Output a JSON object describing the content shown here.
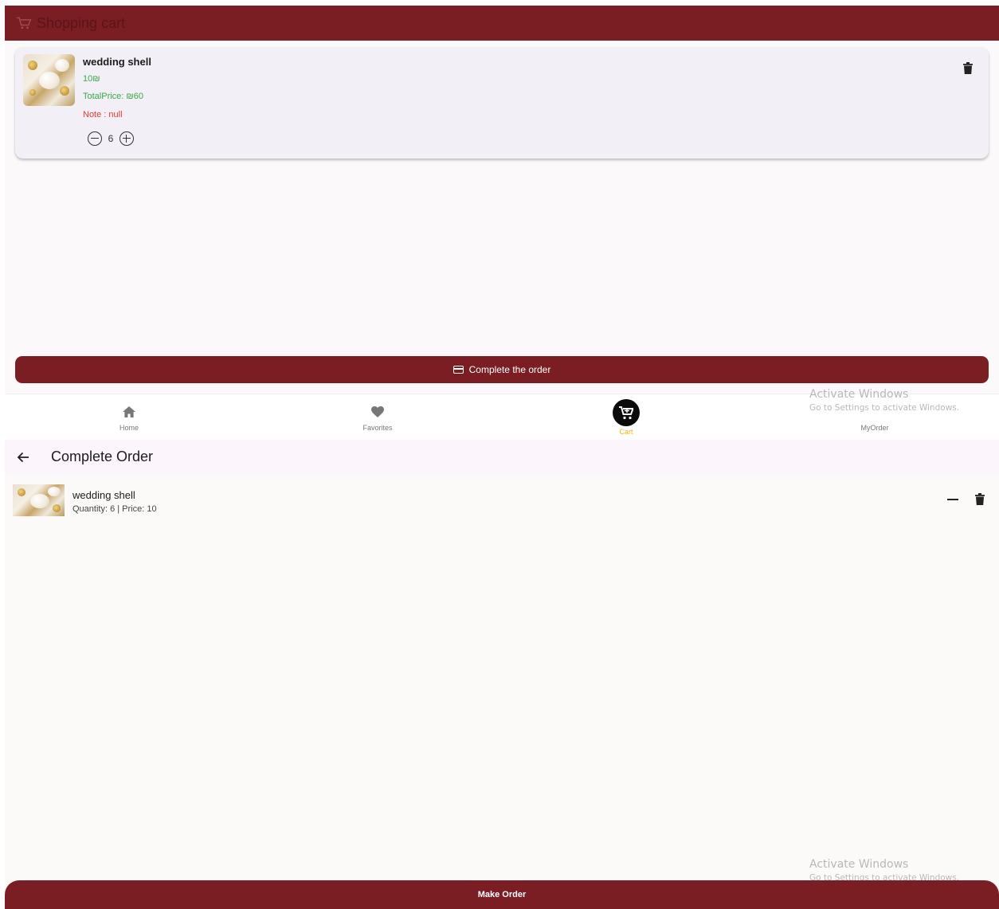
{
  "cart_screen": {
    "title": "Shopping cart",
    "item": {
      "name": "wedding shell",
      "price": "10₪",
      "total_price": "TotalPrice: ₪60",
      "note": "Note : null",
      "quantity": "6"
    },
    "complete_button": "Complete the order",
    "nav": {
      "home": "Home",
      "favorites": "Favorites",
      "cart": "Cart",
      "my_order": "MyOrder"
    },
    "colors": {
      "primary": "#7b1e24",
      "price_green": "#3aa84a",
      "note_red": "#e53935",
      "active_nav": "#f2b705"
    }
  },
  "complete_order_screen": {
    "title": "Complete Order",
    "item": {
      "name": "wedding shell",
      "details": "Quantity: 6 | Price: 10"
    },
    "make_order_button": "Make Order"
  },
  "watermark": {
    "title": "Activate Windows",
    "subtitle": "Go to Settings to activate Windows."
  }
}
